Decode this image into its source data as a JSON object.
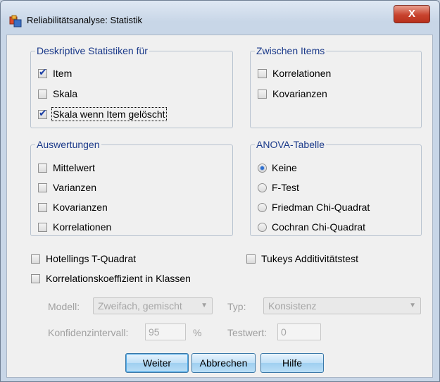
{
  "window": {
    "title": "Reliabilitätsanalyse: Statistik",
    "close_label": "X"
  },
  "descriptive": {
    "title": "Deskriptive Statistiken für",
    "items": [
      {
        "label": "Item",
        "checked": true
      },
      {
        "label": "Skala",
        "checked": false
      },
      {
        "label": "Skala wenn Item gelöscht",
        "checked": true
      }
    ]
  },
  "between_items": {
    "title": "Zwischen Items",
    "items": [
      {
        "label": "Korrelationen",
        "checked": false
      },
      {
        "label": "Kovarianzen",
        "checked": false
      }
    ]
  },
  "summaries": {
    "title": "Auswertungen",
    "items": [
      {
        "label": "Mittelwert",
        "checked": false
      },
      {
        "label": "Varianzen",
        "checked": false
      },
      {
        "label": "Kovarianzen",
        "checked": false
      },
      {
        "label": "Korrelationen",
        "checked": false
      }
    ]
  },
  "anova": {
    "title": "ANOVA-Tabelle",
    "options": [
      {
        "label": "Keine",
        "selected": true
      },
      {
        "label": "F-Test",
        "selected": false
      },
      {
        "label": "Friedman Chi-Quadrat",
        "selected": false
      },
      {
        "label": "Cochran Chi-Quadrat",
        "selected": false
      }
    ]
  },
  "hotelling": {
    "label": "Hotellings T-Quadrat",
    "checked": false
  },
  "tukey": {
    "label": "Tukeys Additivitätstest",
    "checked": false
  },
  "icc": {
    "label": "Korrelationskoeffizient in Klassen",
    "checked": false,
    "model_label": "Modell:",
    "model_value": "Zweifach, gemischt",
    "type_label": "Typ:",
    "type_value": "Konsistenz",
    "ci_label": "Konfidenzintervall:",
    "ci_value": "95",
    "ci_unit": "%",
    "test_label": "Testwert:",
    "test_value": "0"
  },
  "buttons": {
    "continue": "Weiter",
    "cancel": "Abbrechen",
    "help": "Hilfe"
  }
}
